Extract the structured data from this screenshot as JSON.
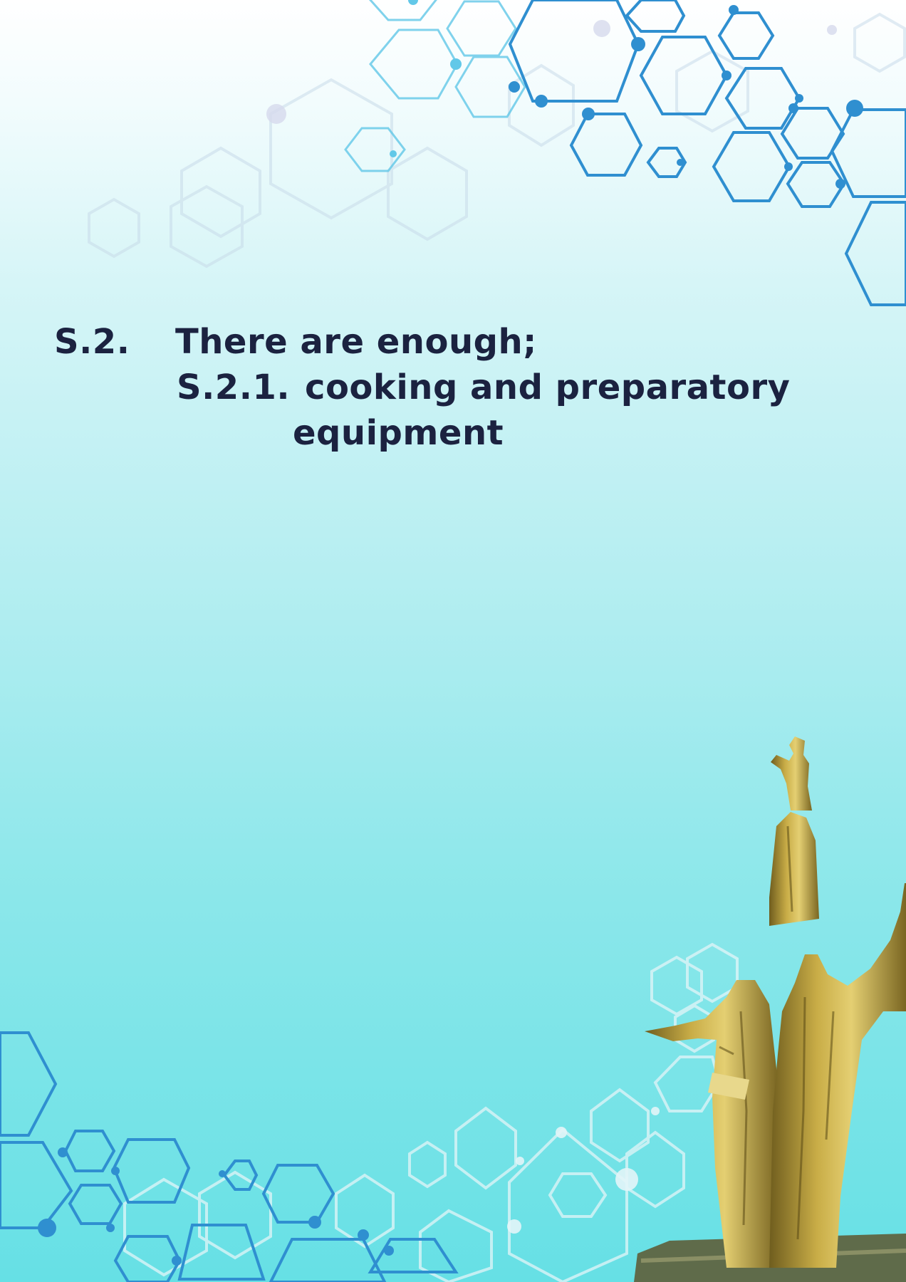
{
  "document": {
    "section_number": "S.2.",
    "section_text": "There are enough;",
    "subsection_number": "S.2.1.",
    "subsection_text_line1": "cooking and preparatory",
    "subsection_text_line2": "equipment"
  },
  "decorations": {
    "top_right": "hexagon-network-graphic",
    "bottom_left": "hexagon-network-graphic",
    "bottom_right": "golden-monument-statue"
  },
  "colors": {
    "text": "#1b2240",
    "hexagon_blue": "#2e86c8",
    "hexagon_light": "#4fc3e6",
    "statue_gold": "#b59a35"
  }
}
